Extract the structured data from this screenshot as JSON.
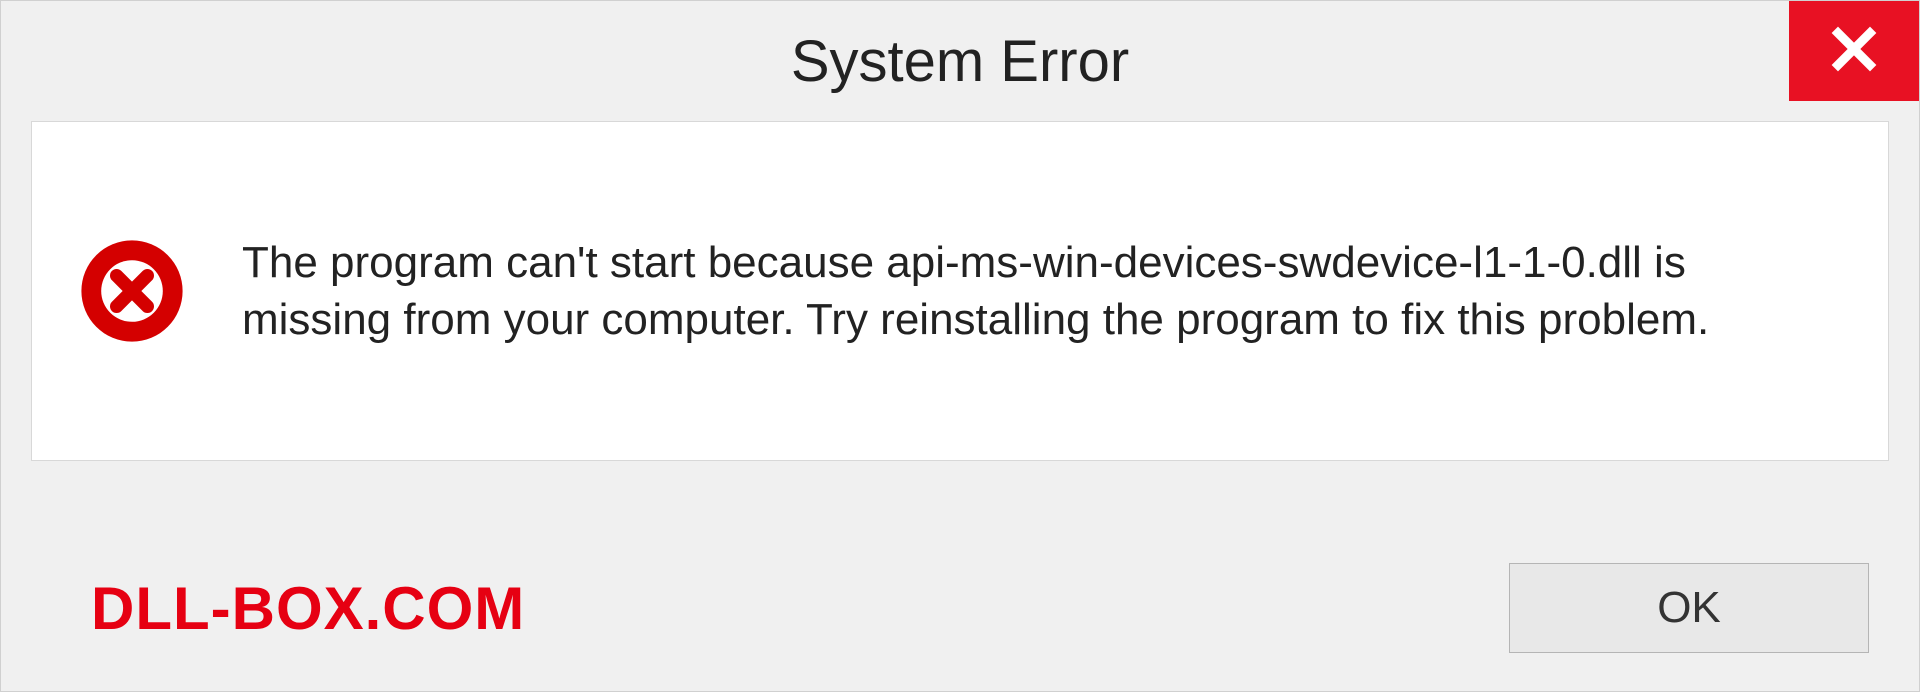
{
  "titlebar": {
    "title": "System Error",
    "close_icon": "close-icon"
  },
  "content": {
    "error_icon": "error-circle-x-icon",
    "message": "The program can't start because api-ms-win-devices-swdevice-l1-1-0.dll is missing from your computer. Try reinstalling the program to fix this problem."
  },
  "footer": {
    "watermark": "DLL-BOX.COM",
    "ok_label": "OK"
  },
  "colors": {
    "close_bg": "#e81123",
    "error_red": "#d40000",
    "watermark_red": "#e60012"
  }
}
